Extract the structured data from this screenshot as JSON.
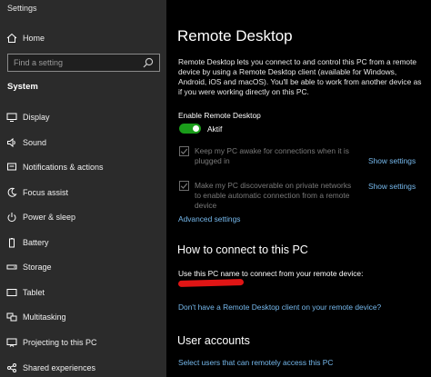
{
  "window": {
    "title": "Settings"
  },
  "sidebar": {
    "home_label": "Home",
    "search_placeholder": "Find a setting",
    "section_heading": "System",
    "items": [
      {
        "label": "Display",
        "icon": "display-icon"
      },
      {
        "label": "Sound",
        "icon": "speaker-icon"
      },
      {
        "label": "Notifications & actions",
        "icon": "notification-icon"
      },
      {
        "label": "Focus assist",
        "icon": "moon-icon"
      },
      {
        "label": "Power & sleep",
        "icon": "power-icon"
      },
      {
        "label": "Battery",
        "icon": "battery-icon"
      },
      {
        "label": "Storage",
        "icon": "storage-icon"
      },
      {
        "label": "Tablet",
        "icon": "tablet-icon"
      },
      {
        "label": "Multitasking",
        "icon": "multitasking-icon"
      },
      {
        "label": "Projecting to this PC",
        "icon": "projector-icon"
      },
      {
        "label": "Shared experiences",
        "icon": "shared-icon"
      }
    ]
  },
  "main": {
    "title": "Remote Desktop",
    "description": "Remote Desktop lets you connect to and control this PC from a remote device by using a Remote Desktop client (available for Windows, Android, iOS and macOS). You'll be able to work from another device as if you were working directly on this PC.",
    "enable_label": "Enable Remote Desktop",
    "toggle_state": "Aktif",
    "toggle_on": true,
    "options": [
      {
        "text": "Keep my PC awake for connections when it is plugged in",
        "checked": true,
        "link": "Show settings"
      },
      {
        "text": "Make my PC discoverable on private networks to enable automatic connection from a remote device",
        "checked": true,
        "link": "Show settings"
      }
    ],
    "advanced_link": "Advanced settings",
    "connect_heading": "How to connect to this PC",
    "connect_text": "Use this PC name to connect from your remote device:",
    "client_link": "Don't have a Remote Desktop client on your remote device?",
    "accounts_heading": "User accounts",
    "accounts_link": "Select users that can remotely access this PC"
  },
  "colors": {
    "accent_link": "#76b9ed",
    "toggle_on": "#1a9c1a",
    "sidebar_bg": "#2b2b2b",
    "redaction": "#e01515"
  }
}
